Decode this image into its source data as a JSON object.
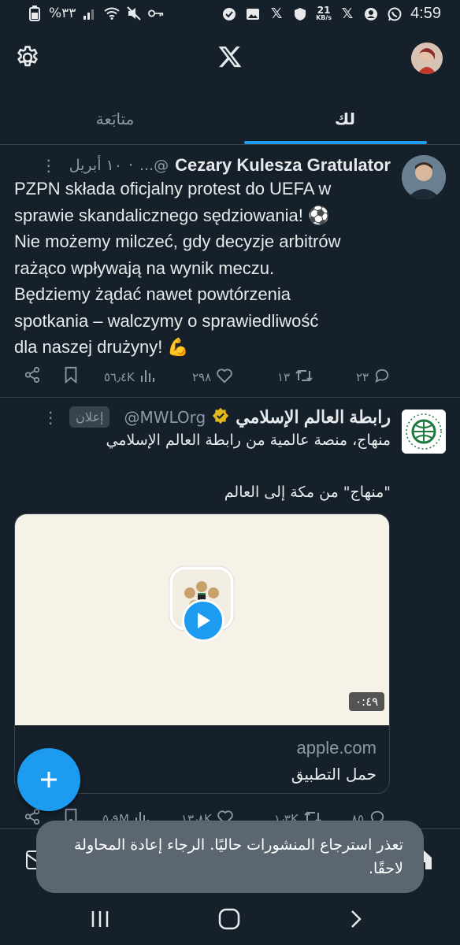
{
  "status_bar": {
    "battery": "%٣٣",
    "time": "4:59",
    "net_speed": "21",
    "net_unit": "KB/s"
  },
  "header": {
    "logo": "X"
  },
  "tabs": [
    {
      "label": "لك",
      "active": true
    },
    {
      "label": "متابَعة",
      "active": false
    }
  ],
  "post1": {
    "name": "Cezary Kulesza Gratulator",
    "handle": "...@",
    "date": "١٠ أبريل",
    "text_lines": [
      "PZPN składa oficjalny protest do UEFA w",
      "sprawie skandalicznego sędziowania! ⚽",
      "Nie możemy milczeć, gdy decyzje arbitrów",
      "rażąco wpływają na wynik meczu.",
      "Będziemy żądać nawet powtórzenia",
      "spotkania – walczymy o sprawiedliwość",
      "dla naszej drużyny! 💪"
    ],
    "replies": "٢٣",
    "reposts": "١٣",
    "likes": "٢٩٨",
    "views": "٥٦٫٤K"
  },
  "post2": {
    "name": "رابطة العالم الإسلامي",
    "handle": "@MWLOrg",
    "ad_badge": "إعلان",
    "text_line1": "منهاج، منصة عالمية من رابطة العالم الإسلامي",
    "text_line2": "\"منهاج\" من مكة إلى العالم",
    "video_duration": "٠:٤٩",
    "card_domain": "apple.com",
    "card_title": "حمل التطبيق",
    "replies": "٨٥",
    "reposts": "١٫٣K",
    "likes": "١٣٫٨K",
    "views": "٥٫٩M"
  },
  "toast": {
    "message": "تعذر استرجاع المنشورات حاليًا. الرجاء إعادة المحاولة لاحقًا."
  },
  "colors": {
    "background": "#15202b",
    "accent": "#1d9bf0",
    "border": "#38444d",
    "muted": "#8b98a5",
    "verified_gold": "#e2b719"
  }
}
